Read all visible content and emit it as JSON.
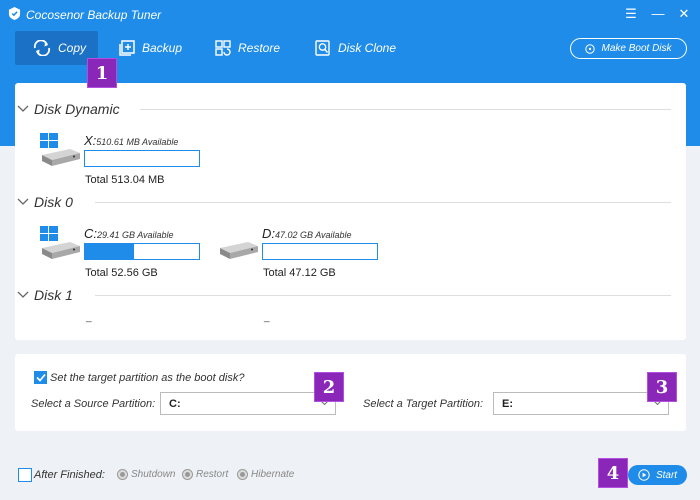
{
  "window": {
    "title": "Cocosenor Backup Tuner",
    "menu_glyph": "☰",
    "minimize_glyph": "—",
    "close_glyph": "✕"
  },
  "tabs": [
    {
      "label": "Copy",
      "active": true,
      "icon": "copy-refresh-icon"
    },
    {
      "label": "Backup",
      "active": false,
      "icon": "plus-square-icon"
    },
    {
      "label": "Restore",
      "active": false,
      "icon": "grid-restore-icon"
    },
    {
      "label": "Disk Clone",
      "active": false,
      "icon": "disk-clone-icon"
    }
  ],
  "make_boot_disk_label": "Make Boot Disk",
  "markers": [
    "1",
    "2",
    "3",
    "4"
  ],
  "disks": [
    {
      "name": "Disk Dynamic",
      "partitions": [
        {
          "letter": "X:",
          "available": "510.61 MB Available",
          "total": "Total 513.04 MB",
          "used_fraction": 0.0,
          "icon": "windows-drive-icon"
        }
      ]
    },
    {
      "name": "Disk 0",
      "partitions": [
        {
          "letter": "C:",
          "available": "29.41 GB Available",
          "total": "Total 52.56 GB",
          "used_fraction": 0.43,
          "icon": "windows-drive-icon"
        },
        {
          "letter": "D:",
          "available": "47.02 GB Available",
          "total": "Total 47.12 GB",
          "used_fraction": 0.0,
          "icon": "drive-icon"
        }
      ]
    },
    {
      "name": "Disk 1",
      "partitions": [
        {
          "letter": "_"
        },
        {
          "letter": "_"
        }
      ]
    }
  ],
  "options": {
    "boot_checkbox_label": "Set the target partition as the boot disk?",
    "boot_checked": true,
    "source_label": "Select a Source Partition:",
    "source_value": "C:",
    "target_label": "Select a Target Partition:",
    "target_value": "E:"
  },
  "footer": {
    "after_finished_label": "After Finished:",
    "radios": [
      "Shutdown",
      "Restort",
      "Hibernate"
    ],
    "start_label": "Start"
  },
  "colors": {
    "accent": "#1e8ce8",
    "marker": "#8b27b8"
  }
}
